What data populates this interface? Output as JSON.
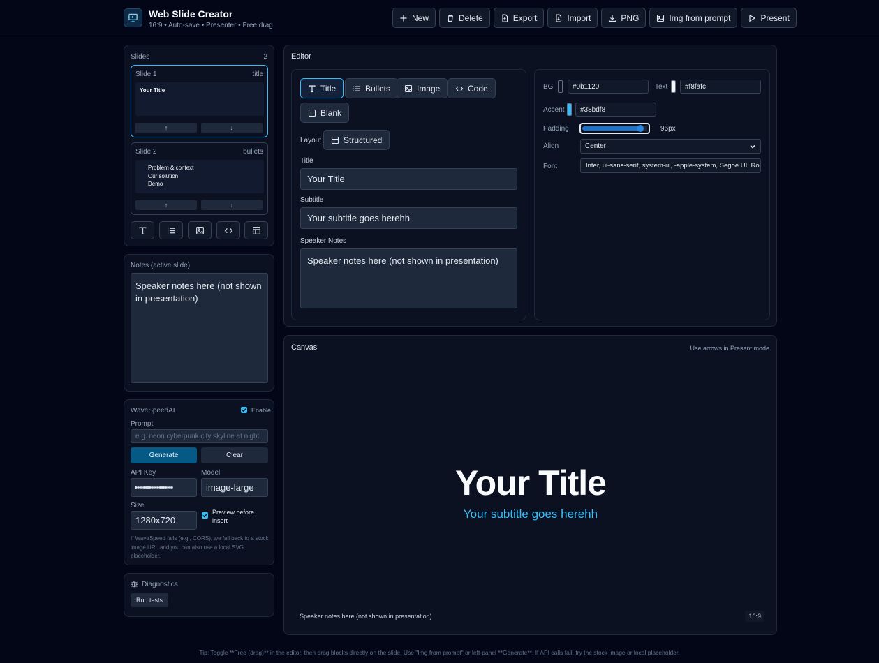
{
  "header": {
    "title": "Web Slide Creator",
    "subtitle": "16:9 • Auto-save • Presenter • Free drag",
    "buttons": [
      {
        "label": "New",
        "icon": "plus-icon"
      },
      {
        "label": "Delete",
        "icon": "trash-icon"
      },
      {
        "label": "Export",
        "icon": "file-export-icon"
      },
      {
        "label": "Import",
        "icon": "file-import-icon"
      },
      {
        "label": "PNG",
        "icon": "download-icon"
      },
      {
        "label": "Img from prompt",
        "icon": "image-icon"
      },
      {
        "label": "Present",
        "icon": "play-icon"
      }
    ]
  },
  "slides_panel": {
    "label": "Slides",
    "count": "2",
    "slides": [
      {
        "name": "Slide 1",
        "type": "title",
        "preview_title": "Your Title",
        "up": "↑",
        "down": "↓"
      },
      {
        "name": "Slide 2",
        "type": "bullets",
        "preview_lines": [
          "Problem & context",
          "Our solution",
          "Demo"
        ],
        "up": "↑",
        "down": "↓"
      }
    ],
    "add_icons": [
      "text-icon",
      "list-icon",
      "image-icon",
      "code-icon",
      "layout-icon"
    ]
  },
  "notes_panel": {
    "label": "Notes (active slide)",
    "value": "Speaker notes here (not shown in presentation)"
  },
  "wavespeed": {
    "label": "WaveSpeedAI",
    "enable_label": "Enable",
    "enable_checked": true,
    "prompt_label": "Prompt",
    "prompt_placeholder": "e.g. neon cyberpunk city skyline at night",
    "generate_label": "Generate",
    "clear_label": "Clear",
    "api_key_label": "API Key",
    "api_key_value": "•••••••••••••••••••",
    "model_label": "Model",
    "model_value": "image-large",
    "size_label": "Size",
    "size_value": "1280x720",
    "preview_label": "Preview before insert",
    "preview_checked": true,
    "help": "If WaveSpeed fails (e.g., CORS), we fall back to a stock image URL and you can also use a local SVG placeholder."
  },
  "diagnostics": {
    "label": "Diagnostics",
    "run_label": "Run tests"
  },
  "editor": {
    "label": "Editor",
    "block_types": [
      {
        "label": "Title",
        "icon": "text-icon",
        "active": true
      },
      {
        "label": "Bullets",
        "icon": "list-icon",
        "active": false
      },
      {
        "label": "Image",
        "icon": "image-icon",
        "active": false
      },
      {
        "label": "Code",
        "icon": "code-icon",
        "active": false
      },
      {
        "label": "Blank",
        "icon": "layout-icon",
        "active": false
      }
    ],
    "layout_label": "Layout",
    "layout_value": "Structured",
    "title_label": "Title",
    "title_value": "Your Title",
    "subtitle_label": "Subtitle",
    "subtitle_value": "Your subtitle goes herehh",
    "notes_label": "Speaker Notes",
    "notes_value": "Speaker notes here (not shown in presentation)",
    "style": {
      "bg_label": "BG",
      "bg_value": "#0b1120",
      "text_label": "Text",
      "text_value": "#f8fafc",
      "accent_label": "Accent",
      "accent_value": "#38bdf8",
      "padding_label": "Padding",
      "padding_value": "96px",
      "padding_fraction": 0.95,
      "align_label": "Align",
      "align_value": "Center",
      "font_label": "Font",
      "font_value": "Inter, ui-sans-serif, system-ui, -apple-system, Segoe UI, Roboto"
    }
  },
  "canvas": {
    "label": "Canvas",
    "hint": "Use arrows in Present mode",
    "slide_title": "Your Title",
    "slide_subtitle": "Your subtitle goes herehh",
    "notes": "Speaker notes here (not shown in presentation)",
    "ratio": "16:9"
  },
  "footer": {
    "tip": "Tip: Toggle **Free (drag)** in the editor, then drag blocks directly on the slide. Use \"Img from prompt\" or left-panel **Generate**. If API calls fail, try the stock image or local placeholder."
  },
  "colors": {
    "accent": "#38bdf8",
    "background": "#020617",
    "panel": "#0b1120",
    "primary_button": "#075985"
  }
}
